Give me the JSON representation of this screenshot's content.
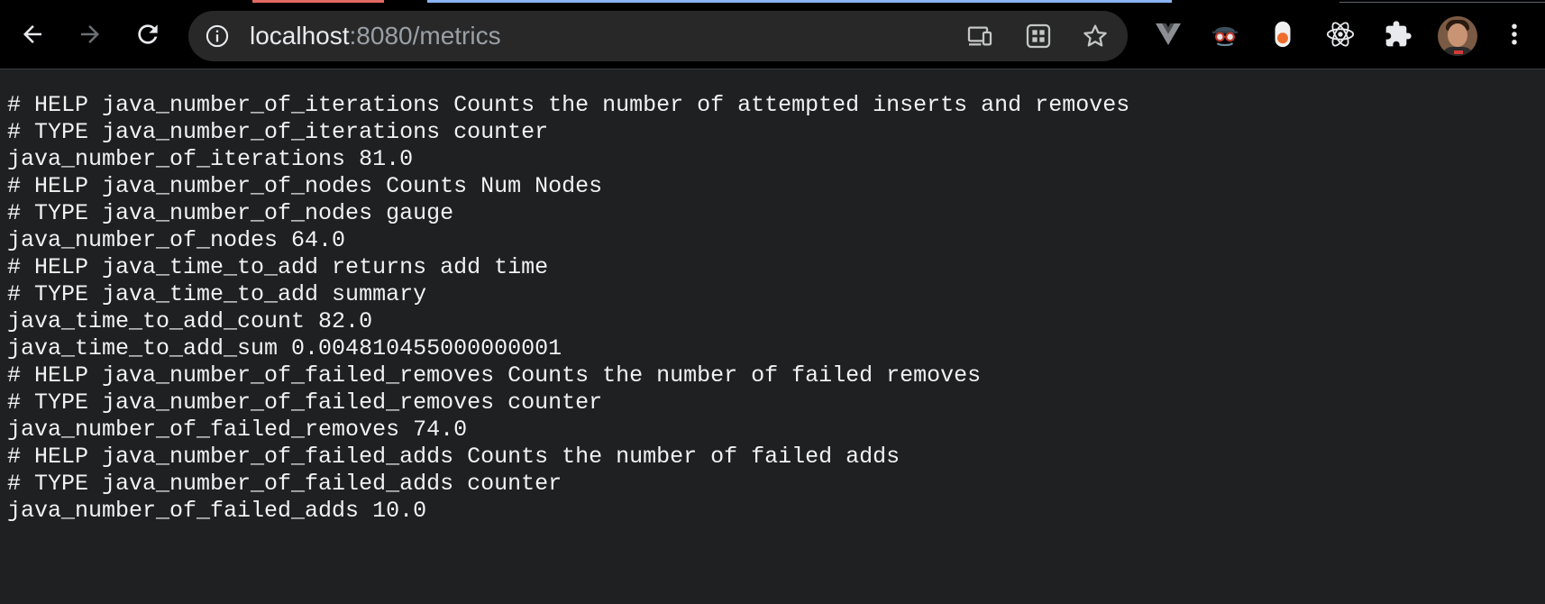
{
  "browser": {
    "url": {
      "host": "localhost",
      "port_path": ":8080/metrics"
    },
    "icons": {
      "back": "back-arrow-icon",
      "forward": "forward-arrow-icon",
      "reload": "reload-icon",
      "site_info": "info-icon",
      "cast": "cast-icon",
      "tab_groups": "apps-grid-icon",
      "bookmark": "star-icon",
      "menu": "kebab-menu-icon"
    },
    "extensions": [
      "vue-devtools-icon",
      "detective-extension-icon",
      "toggle-extension-icon",
      "react-devtools-icon",
      "puzzle-piece-icon"
    ],
    "colors": {
      "toolbar": "#000000",
      "omnibox": "#282828",
      "page_bg": "#1e2021",
      "text": "#f2f2f2",
      "tab_accent_red": "#e46962",
      "tab_accent_blue": "#8ab4f8"
    }
  },
  "metrics_lines": [
    "# HELP java_number_of_iterations Counts the number of attempted inserts and removes",
    "# TYPE java_number_of_iterations counter",
    "java_number_of_iterations 81.0",
    "# HELP java_number_of_nodes Counts Num Nodes",
    "# TYPE java_number_of_nodes gauge",
    "java_number_of_nodes 64.0",
    "# HELP java_time_to_add returns add time",
    "# TYPE java_time_to_add summary",
    "java_time_to_add_count 82.0",
    "java_time_to_add_sum 0.004810455000000001",
    "# HELP java_number_of_failed_removes Counts the number of failed removes",
    "# TYPE java_number_of_failed_removes counter",
    "java_number_of_failed_removes 74.0",
    "# HELP java_number_of_failed_adds Counts the number of failed adds",
    "# TYPE java_number_of_failed_adds counter",
    "java_number_of_failed_adds 10.0"
  ]
}
